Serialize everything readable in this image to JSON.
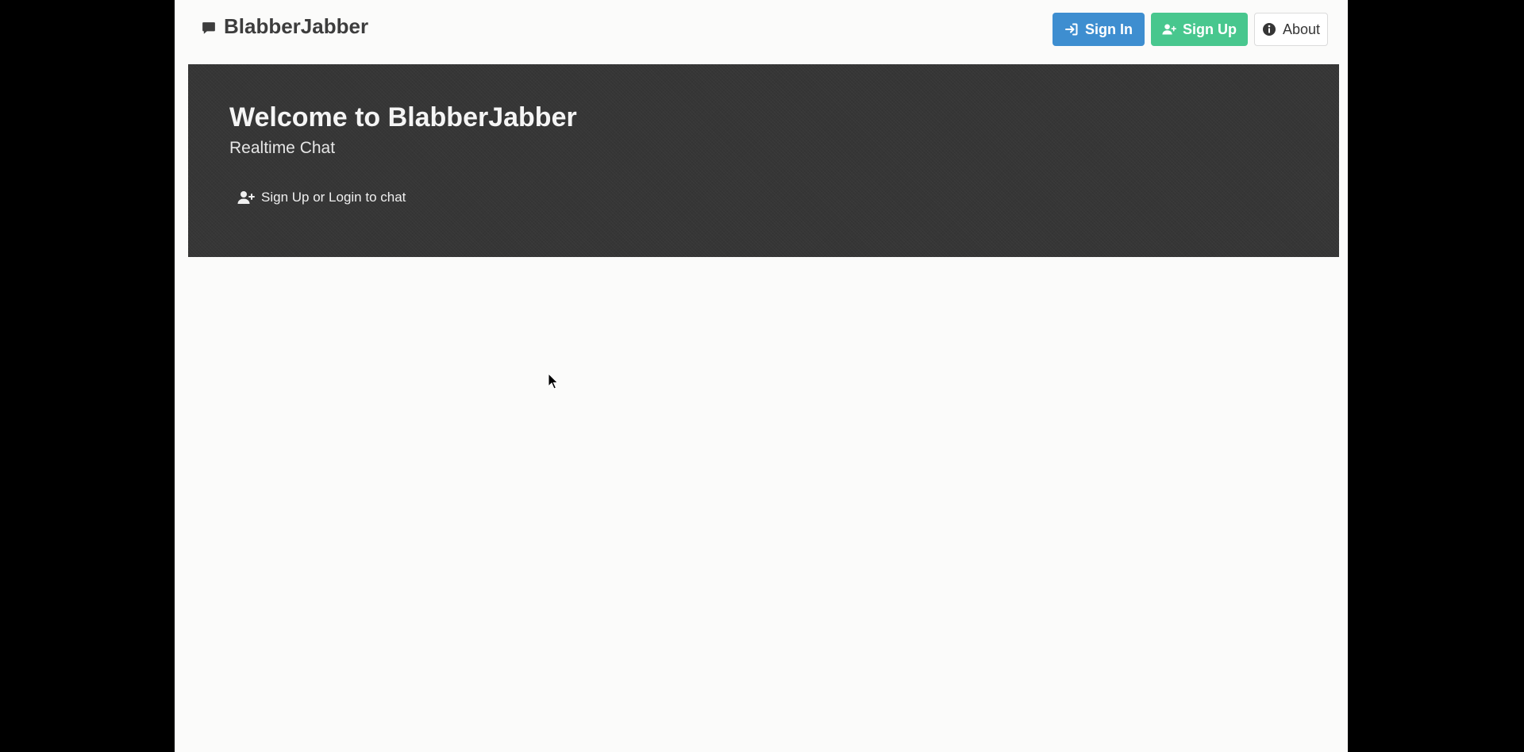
{
  "app": {
    "brand_name": "BlabberJabber",
    "brand_icon": "chat-bubble-icon"
  },
  "navbar": {
    "sign_in_label": "Sign In",
    "sign_up_label": "Sign Up",
    "about_label": "About",
    "icons": {
      "sign_in": "sign-in-arrow-icon",
      "sign_up": "user-plus-icon",
      "about": "info-circle-icon"
    }
  },
  "hero": {
    "title": "Welcome to BlabberJabber",
    "subtitle": "Realtime Chat",
    "cta_label": "Sign Up or Login to chat",
    "cta_icon": "user-plus-icon"
  },
  "colors": {
    "primary": "#3e8ed0",
    "success": "#48c78e",
    "hero_bg": "#363636",
    "page_bg": "#fbfbfa"
  }
}
